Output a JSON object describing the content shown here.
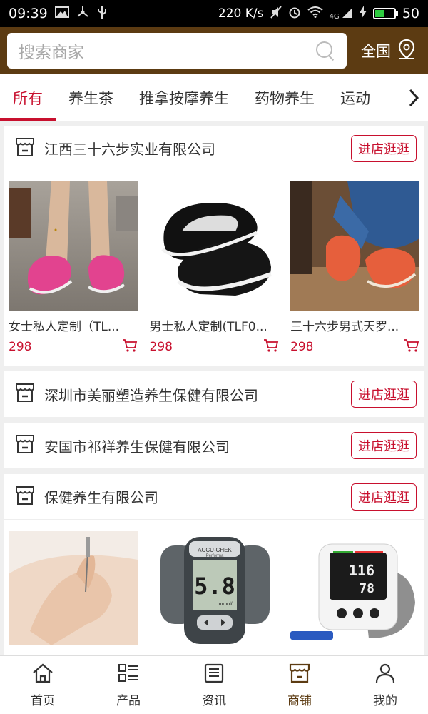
{
  "statusbar": {
    "time": "09:39",
    "speed": "220 K/s",
    "signal": "4G",
    "battery": "50",
    "battery_fraction": 0.5
  },
  "header": {
    "search_placeholder": "搜索商家",
    "region": "全国"
  },
  "tabs": [
    "所有",
    "养生茶",
    "推拿按摩养生",
    "药物养生",
    "运动"
  ],
  "active_tab": "所有",
  "shops": [
    {
      "name": "江西三十六步实业有限公司",
      "enter_label": "进店逛逛",
      "products": [
        {
          "title": "女士私人定制（TL...",
          "price": "298"
        },
        {
          "title": "男士私人定制(TLF0...",
          "price": "298"
        },
        {
          "title": "三十六步男式天罗...",
          "price": "298"
        }
      ]
    },
    {
      "name": "深圳市美丽塑造养生保健有限公司",
      "enter_label": "进店逛逛"
    },
    {
      "name": "安国市祁祥养生保健有限公司",
      "enter_label": "进店逛逛"
    },
    {
      "name": "保健养生有限公司",
      "enter_label": "进店逛逛",
      "product_images": [
        {
          "meter_reading": "5.8",
          "meter_unit": "mmol/L",
          "meter_brand": "ACCU-CHEK",
          "meter_model": "Performa"
        },
        {
          "bp_sys": "116",
          "bp_dia": "78"
        }
      ]
    }
  ],
  "bottom_nav": [
    {
      "label": "首页",
      "icon": "home-icon"
    },
    {
      "label": "产品",
      "icon": "grid-list-icon"
    },
    {
      "label": "资讯",
      "icon": "news-icon"
    },
    {
      "label": "商铺",
      "icon": "shop-icon",
      "active": true
    },
    {
      "label": "我的",
      "icon": "user-icon"
    }
  ],
  "colors": {
    "accent": "#c8102e",
    "header_bg": "#5c3b12"
  }
}
